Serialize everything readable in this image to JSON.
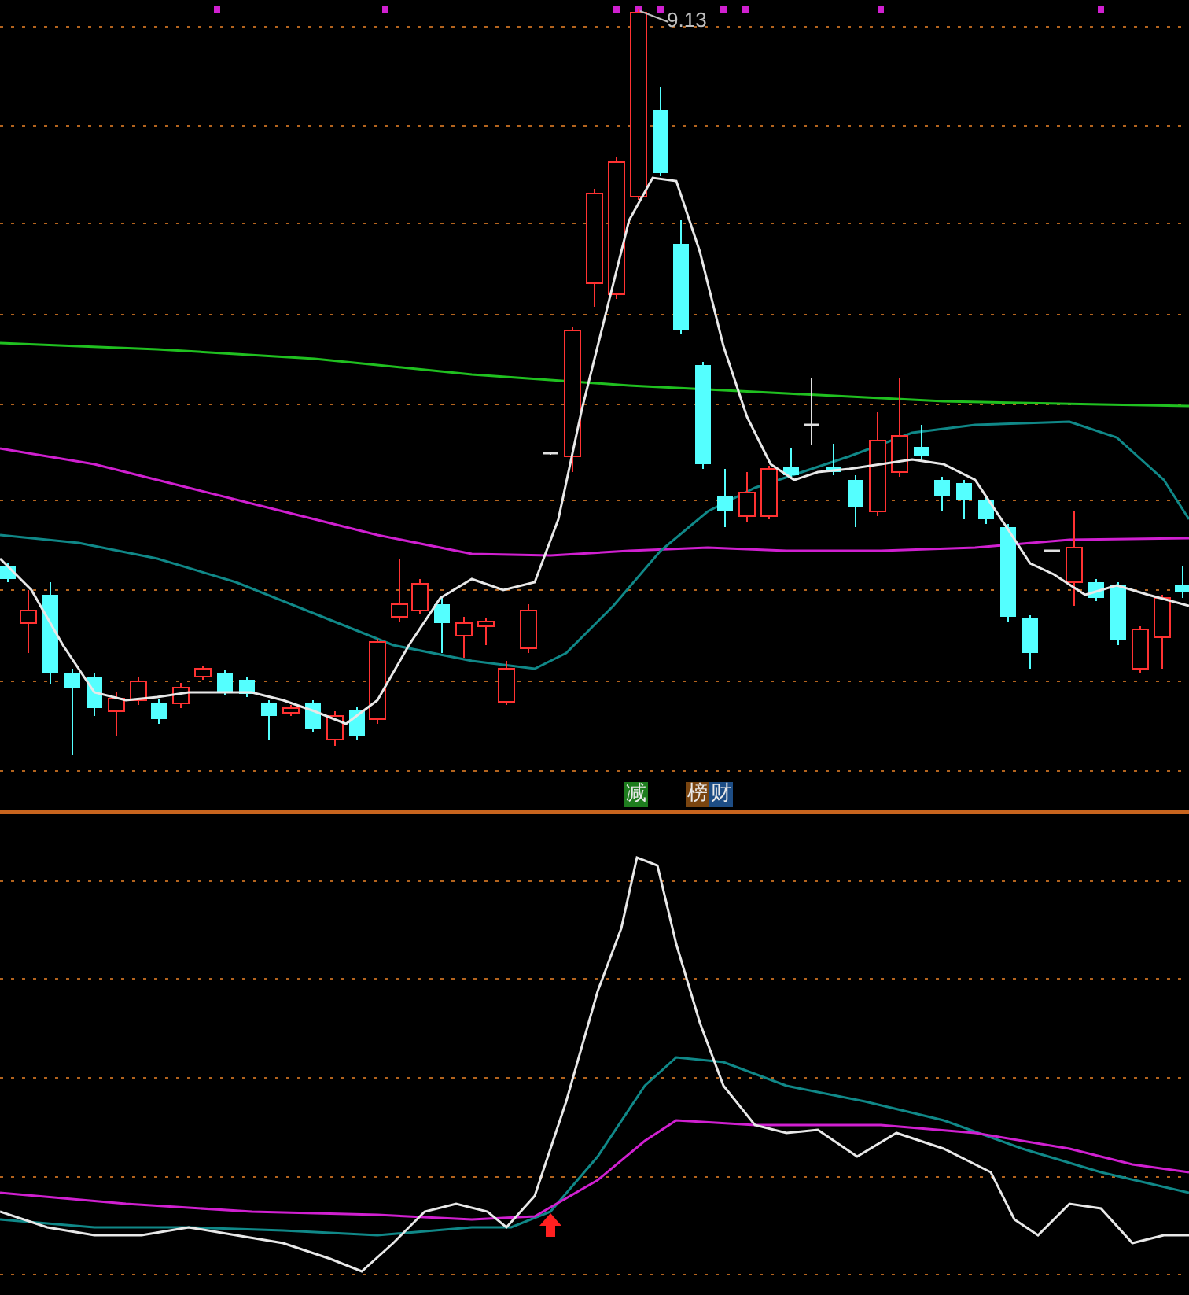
{
  "price_label": {
    "text": "9.13"
  },
  "signal_tags": [
    {
      "text": "减",
      "color": "#1e7d1e"
    },
    {
      "text": "榜",
      "color": "#7a4510"
    },
    {
      "text": "财",
      "color": "#1d4d85"
    }
  ]
}
